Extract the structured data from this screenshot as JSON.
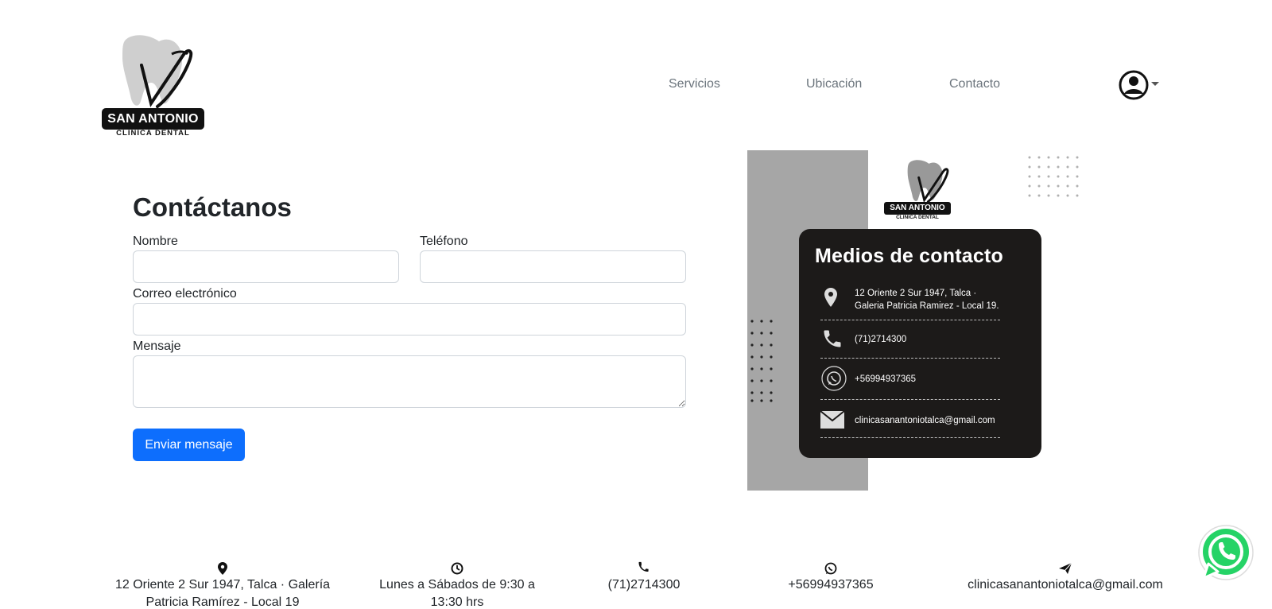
{
  "header": {
    "logo": {
      "name": "SAN ANTONIO",
      "subtitle": "CLINICA DENTAL"
    },
    "nav": [
      {
        "label": "Servicios"
      },
      {
        "label": "Ubicación"
      },
      {
        "label": "Contacto"
      }
    ],
    "user_icon": "user-circle-icon"
  },
  "form": {
    "title": "Contáctanos",
    "fields": {
      "nombre": {
        "label": "Nombre",
        "value": ""
      },
      "telefono": {
        "label": "Teléfono",
        "value": ""
      },
      "correo": {
        "label": "Correo electrónico",
        "value": ""
      },
      "mensaje": {
        "label": "Mensaje",
        "value": ""
      }
    },
    "submit_label": "Enviar mensaje"
  },
  "contact_card": {
    "logo": {
      "name": "SAN ANTONIO",
      "subtitle": "CLINICA DENTAL"
    },
    "title": "Medios de contacto",
    "rows": [
      {
        "icon": "map-pin-icon",
        "line1": "12 Oriente 2 Sur 1947, Talca ·",
        "line2": "Galeria Patricia Ramirez - Local 19."
      },
      {
        "icon": "phone-icon",
        "text": "(71)2714300"
      },
      {
        "icon": "whatsapp-icon",
        "text": "+56994937365"
      },
      {
        "icon": "mail-icon",
        "text": "clinicasanantoniotalca@gmail.com"
      }
    ]
  },
  "footer": {
    "address": {
      "icon": "map-pin-icon",
      "line1": "12 Oriente 2 Sur 1947, Talca · Galería",
      "line2": "Patricia Ramírez - Local 19"
    },
    "hours": {
      "icon": "clock-icon",
      "line1": "Lunes a Sábados de 9:30 a",
      "line2": "13:30 hrs"
    },
    "phone": {
      "icon": "phone-icon",
      "text": "(71)2714300"
    },
    "whatsapp": {
      "icon": "whatsapp-icon",
      "text": "+56994937365"
    },
    "email": {
      "icon": "send-icon",
      "text": "clinicasanantoniotalca@gmail.com"
    }
  },
  "colors": {
    "primary_button": "#0d6efd",
    "card_bg": "#1c1a19",
    "panel_gray": "#a6a6a6",
    "whatsapp_green": "#25d366"
  }
}
